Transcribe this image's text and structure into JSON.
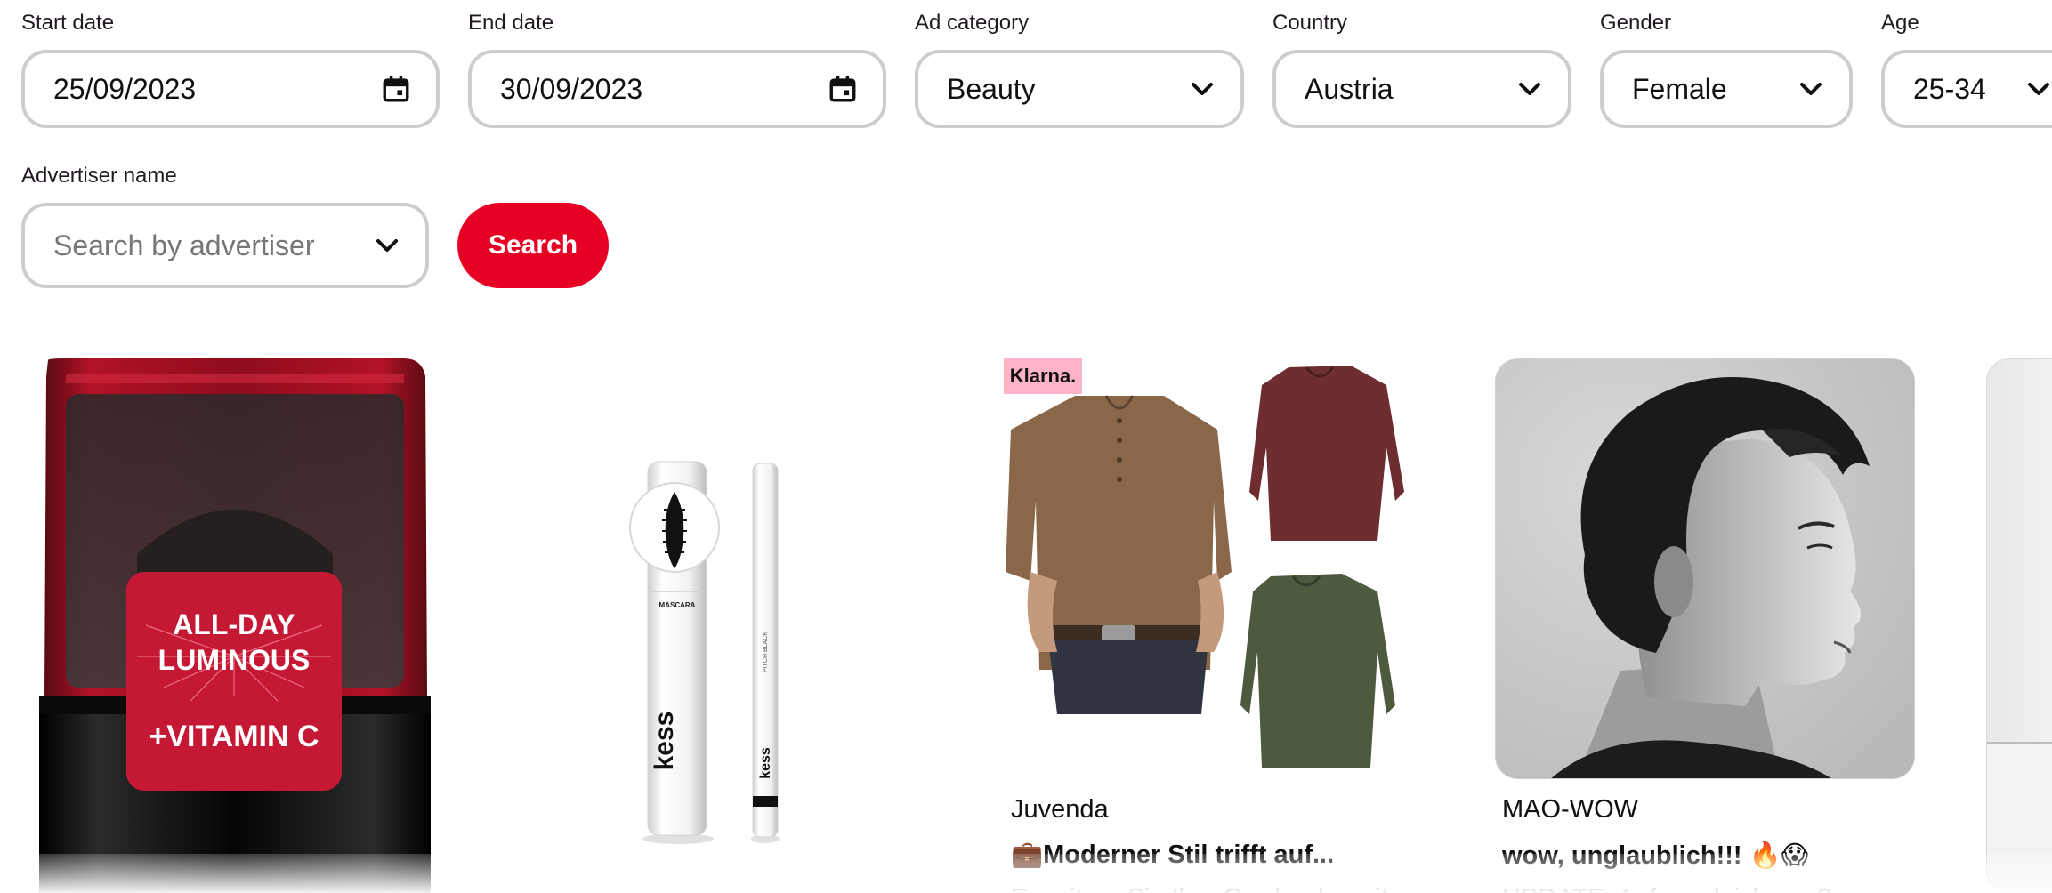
{
  "filters": {
    "start_date": {
      "label": "Start date",
      "value": "25/09/2023",
      "icon": "calendar-icon"
    },
    "end_date": {
      "label": "End date",
      "value": "30/09/2023",
      "icon": "calendar-icon"
    },
    "ad_category": {
      "label": "Ad category",
      "value": "Beauty",
      "icon": "chevron-down-icon"
    },
    "country": {
      "label": "Country",
      "value": "Austria",
      "icon": "chevron-down-icon"
    },
    "gender": {
      "label": "Gender",
      "value": "Female",
      "icon": "chevron-down-icon"
    },
    "age": {
      "label": "Age",
      "value": "25-34",
      "icon": "chevron-down-icon"
    },
    "advertiser": {
      "label": "Advertiser name",
      "placeholder": "Search by advertiser",
      "icon": "chevron-down-icon"
    }
  },
  "search_button": {
    "label": "Search",
    "color": "#e60023"
  },
  "cards": [
    {
      "image": "serum-bottle-image",
      "image_text": [
        "ALL-DAY",
        "LUMINOUS",
        "+VITAMIN C"
      ]
    },
    {
      "image": "mascara-eyeliner-image",
      "product_labels": [
        "MASCARA",
        "kess",
        "PITCH BLACK",
        "kess"
      ]
    },
    {
      "image": "henley-shirts-image",
      "badge": "Klarna.",
      "advertiser": "Juvenda",
      "headline": "💼Moderner Stil trifft auf...",
      "description_partial": "Erweitern Sie Ihre Garderobe mit"
    },
    {
      "image": "woman-profile-portrait",
      "advertiser": "MAO-WOW",
      "headline": "wow, unglaublich!!! 🔥😱",
      "description_partial": "UPDATE: Auf vergleichen...?"
    },
    {
      "image": "partial-product-image"
    }
  ],
  "colors": {
    "brand": "#e60023",
    "field_border": "#cdcdcd",
    "klarna_pink": "#ffb3c7"
  }
}
